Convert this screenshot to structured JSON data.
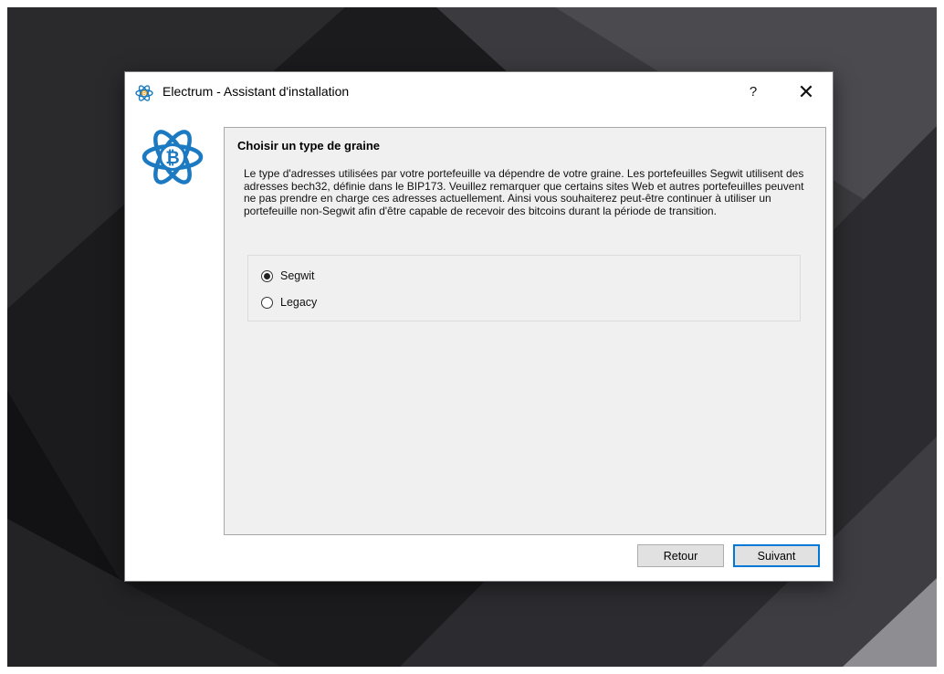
{
  "window": {
    "app_name": "Electrum",
    "title": "Electrum  -  Assistant d'installation",
    "help_label": "?",
    "close_label": "✕",
    "icon": "electrum-bitcoin-icon"
  },
  "logo": {
    "icon": "electrum-atom-logo",
    "color": "#1b7ac1"
  },
  "panel": {
    "title": "Choisir un type de graine",
    "description": "Le type d'adresses utilisées par votre portefeuille va dépendre de votre graine. Les portefeuilles Segwit utilisent des adresses bech32, définie dans le BIP173. Veuillez remarquer que certains sites Web et autres portefeuilles peuvent ne pas prendre en charge ces adresses actuellement. Ainsi vous souhaiterez peut-être continuer à utiliser un portefeuille non-Segwit afin d'être capable de recevoir des bitcoins durant la période de transition."
  },
  "options": [
    {
      "label": "Segwit",
      "checked": true
    },
    {
      "label": "Legacy",
      "checked": false
    }
  ],
  "buttons": {
    "back": "Retour",
    "next": "Suivant"
  },
  "colors": {
    "accent": "#0078d7",
    "desktop": "#1c1c1e",
    "logo_blue": "#1b7ac1"
  }
}
